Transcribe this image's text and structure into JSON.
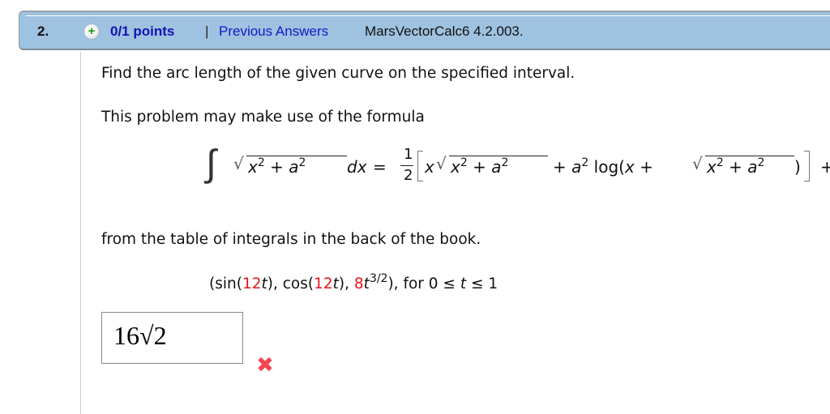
{
  "header": {
    "question_number": "2.",
    "points_icon": "plus-circle-icon",
    "points": "0/1 points",
    "separator": "|",
    "previous_answers": "Previous Answers",
    "source": "MarsVectorCalc6 4.2.003."
  },
  "question": {
    "prompt": "Find the arc length of the given curve on the specified interval.",
    "hint": "This problem may make use of the formula",
    "hint_after": "from the table of integrals in the back of the book.",
    "formula": {
      "integral_sign": "∫",
      "sqrt_sign": "√",
      "x": "x",
      "a": "a",
      "two": "2",
      "plus": "+",
      "dx": "dx",
      "equals": "=",
      "frac_num": "1",
      "frac_den": "2",
      "log": "log(",
      "close_paren": ")",
      "plus_c": "+ C"
    },
    "curve": {
      "open": "(sin(",
      "coef1": "12",
      "t1": "t",
      "mid1": "), cos(",
      "coef2": "12",
      "t2": "t",
      "mid2": "), ",
      "coef3": "8",
      "t3": "t",
      "exp": "3/2",
      "close": "), for 0 ≤ ",
      "t4": "t",
      "end": " ≤ 1"
    }
  },
  "answer": {
    "value": "16√2",
    "status": "incorrect",
    "status_icon": "red-x-icon",
    "status_color": "#f2474f"
  },
  "colors": {
    "header_bg": "#9ec2e0",
    "link": "#1616c8",
    "highlight_red": "#e8141a"
  }
}
